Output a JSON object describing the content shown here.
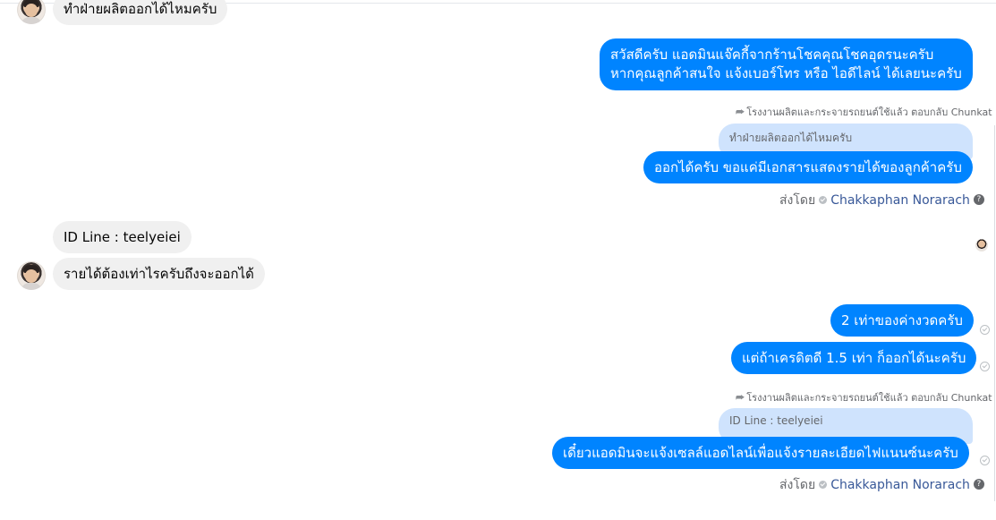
{
  "messages": {
    "m0_incoming_partial": "ทำฝ่ายผลิตออกได้ไหมครับ",
    "m1_out_line1": "สวัสดีครับ แอดมินแจ๊คกี้จากร้านโชคคุณโชคอุดรนะครับ",
    "m1_out_line2": "หากคุณลูกค้าสนใจ แจ้งเบอร์โทร หรือ ไอดีไลน์ ได้เลยนะครับ",
    "reply1_note": "โรงงานผลิตและกระจายรถยนต์ใช้แล้ว ตอบกลับ Chunkat",
    "reply1_quote": "ทำฝ่ายผลิตออกได้ไหมครับ",
    "m2_out": "ออกได้ครับ ขอแค่มีเอกสารแสดงรายได้ของลูกค้าครับ",
    "sent_by_label": "ส่งโดย",
    "sent_by_name": "Chakkaphan Norarach",
    "m3_in": "ID Line : teelyeiei",
    "m4_in": "รายได้ต้องเท่าไรครับถึงจะออกได้",
    "m5_out": "2 เท่าของค่างวดครับ",
    "m6_out": "แต่ถ้าเครดิตดี 1.5 เท่า ก็ออกได้นะครับ",
    "reply2_note": "โรงงานผลิตและกระจายรถยนต์ใช้แล้ว ตอบกลับ Chunkat",
    "reply2_quote": "ID Line : teelyeiei",
    "m7_out": "เดี๋ยวแอดมินจะแจ้งเซลล์แอดไลน์เพื่อแจ้งรายละเอียดไฟแนนซ์นะครับ"
  },
  "icons": {
    "reply": "reply-arrow-icon",
    "sent_check": "check-circle-icon",
    "help": "question-circle-icon"
  },
  "colors": {
    "outgoing_bubble": "#0084ff",
    "incoming_bubble": "#f0f0f0",
    "quote_bubble": "#cfe3fd",
    "name_link": "#385898"
  }
}
